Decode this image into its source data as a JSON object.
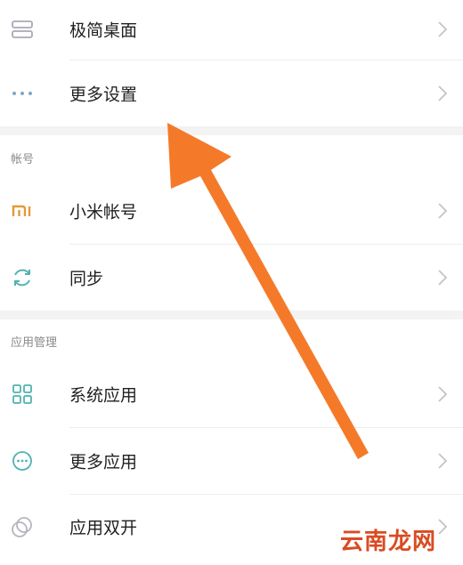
{
  "items": [
    {
      "label": "极简桌面",
      "icon": "layers-icon"
    },
    {
      "label": "更多设置",
      "icon": "more-dots-icon"
    },
    {
      "label": "小米帐号",
      "icon": "mi-logo-icon"
    },
    {
      "label": "同步",
      "icon": "sync-icon"
    },
    {
      "label": "系统应用",
      "icon": "grid-apps-icon"
    },
    {
      "label": "更多应用",
      "icon": "more-circle-icon"
    },
    {
      "label": "应用双开",
      "icon": "dual-circle-icon"
    }
  ],
  "sections": {
    "account": "帐号",
    "app_management": "应用管理"
  },
  "watermark": "云南龙网",
  "colors": {
    "arrow": "#f47a2a",
    "mi_orange": "#e39a3b",
    "icon_teal": "#4fb3b0",
    "chevron": "#c4c4c4"
  }
}
